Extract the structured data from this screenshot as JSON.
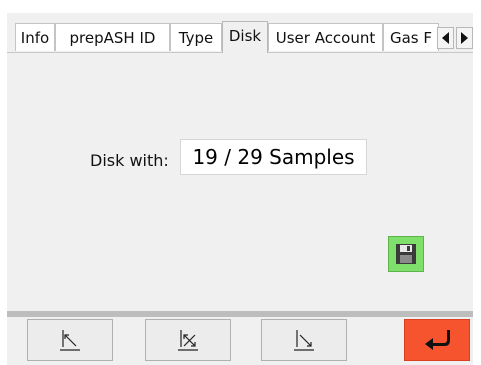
{
  "tabs": [
    {
      "label": "Info",
      "active": false
    },
    {
      "label": "prepASH ID",
      "active": false
    },
    {
      "label": "Type",
      "active": false
    },
    {
      "label": "Disk",
      "active": true
    },
    {
      "label": "User Account",
      "active": false
    },
    {
      "label": "Gas F",
      "active": false
    }
  ],
  "disk": {
    "label": "Disk with:",
    "value": "19 / 29 Samples"
  },
  "icons": {
    "save": "floppy-disk-icon",
    "tab_scroll_left": "triangle-left-icon",
    "tab_scroll_right": "triangle-right-icon",
    "nav_first": "arrow-up-left-icon",
    "nav_middle": "arrow-cross-icon",
    "nav_last": "arrow-down-right-icon",
    "enter": "return-arrow-icon"
  },
  "colors": {
    "save_button": "#7ee06a",
    "enter_button": "#f5542e"
  }
}
